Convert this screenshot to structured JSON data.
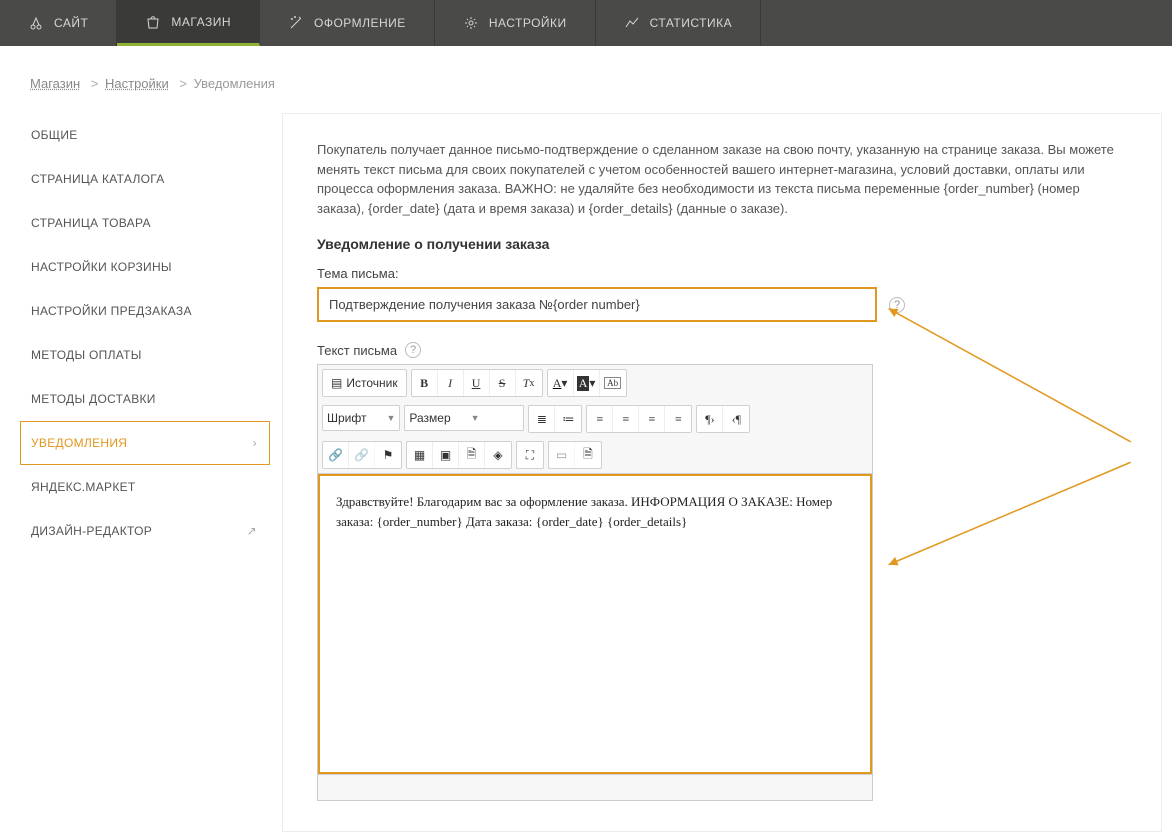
{
  "topnav": [
    {
      "label": "САЙТ",
      "icon": "site"
    },
    {
      "label": "МАГАЗИН",
      "icon": "shop",
      "active": true
    },
    {
      "label": "ОФОРМЛЕНИЕ",
      "icon": "design"
    },
    {
      "label": "НАСТРОЙКИ",
      "icon": "settings"
    },
    {
      "label": "СТАТИСТИКА",
      "icon": "stats"
    }
  ],
  "breadcrumb": {
    "a": "Магазин",
    "b": "Настройки",
    "c": "Уведомления"
  },
  "sidebar": [
    {
      "label": "ОБЩИЕ"
    },
    {
      "label": "СТРАНИЦА КАТАЛОГА"
    },
    {
      "label": "СТРАНИЦА ТОВАРА"
    },
    {
      "label": "НАСТРОЙКИ КОРЗИНЫ"
    },
    {
      "label": "НАСТРОЙКИ ПРЕДЗАКАЗА"
    },
    {
      "label": "МЕТОДЫ ОПЛАТЫ"
    },
    {
      "label": "МЕТОДЫ ДОСТАВКИ"
    },
    {
      "label": "УВЕДОМЛЕНИЯ",
      "selected": true,
      "chevron": true
    },
    {
      "label": "ЯНДЕКС.МАРКЕТ"
    },
    {
      "label": "ДИЗАЙН-РЕДАКТОР",
      "ext": true
    }
  ],
  "main": {
    "intro": "Покупатель получает данное письмо-подтверждение о сделанном заказе на свою почту, указанную на странице заказа. Вы можете менять текст письма для своих покупателей с учетом особенностей вашего интернет-магазина, условий доставки, оплаты или процесса оформления заказа. ВАЖНО: не удаляйте без необходимости из текста письма переменные {order_number} (номер заказа), {order_date} (дата и время заказа) и {order_details} (данные о заказе).",
    "section_title": "Уведомление о получении заказа",
    "subject_label": "Тема письма:",
    "subject_value": "Подтверждение получения заказа №{order number}",
    "body_label": "Текст письма",
    "editor": {
      "source_btn": "Источник",
      "font_select": "Шрифт",
      "size_select": "Размер",
      "body_text": "Здравствуйте! Благодарим вас за оформление заказа. ИНФОРМАЦИЯ О ЗАКАЗЕ: Номер заказа: {order_number} Дата заказа: {order_date} {order_details}"
    }
  }
}
